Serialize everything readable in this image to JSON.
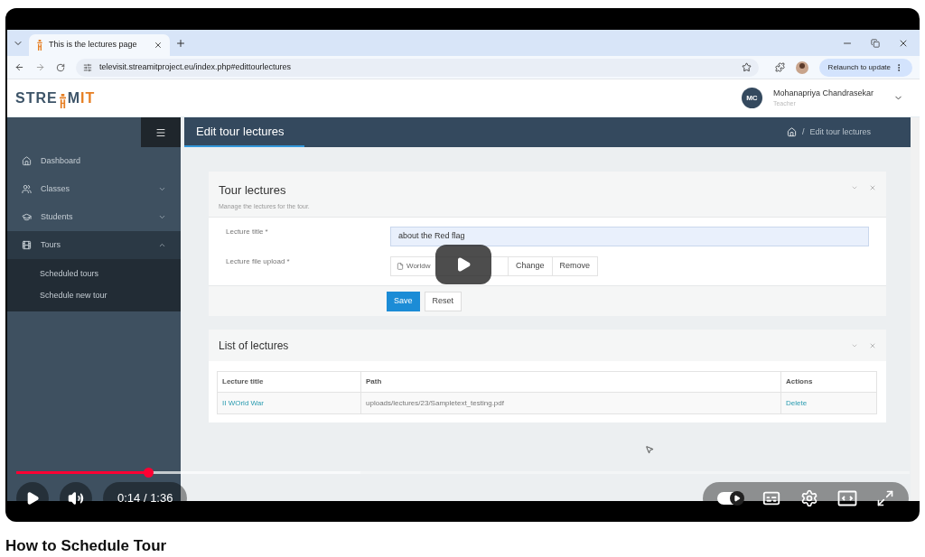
{
  "browser": {
    "tab": {
      "title": "This is the lectures page"
    },
    "url": "televisit.streamitproject.eu/index.php#edittourlectures",
    "relaunch_button": "Relaunch to update"
  },
  "site": {
    "logo": [
      "STRE",
      "M",
      "IT"
    ],
    "user": {
      "initials": "MC",
      "name": "Mohanapriya Chandrasekar",
      "role": "Teacher"
    }
  },
  "sidebar": {
    "items": [
      {
        "label": "Dashboard",
        "selected": false
      },
      {
        "label": "Classes",
        "selected": false,
        "expanded": false
      },
      {
        "label": "Students",
        "selected": false,
        "expanded": false
      },
      {
        "label": "Tours",
        "selected": true,
        "expanded": true,
        "children": [
          {
            "label": "Scheduled tours"
          },
          {
            "label": "Schedule new tour"
          }
        ]
      }
    ]
  },
  "header": {
    "title": "Edit tour lectures",
    "breadcrumb": [
      "/",
      "Edit tour lectures"
    ]
  },
  "form_panel": {
    "title": "Tour lectures",
    "subtitle": "Manage the lectures for the tour.",
    "title_field": {
      "label": "Lecture title *",
      "value": "about the Red flag"
    },
    "file_field": {
      "label": "Lecture file upload *",
      "file": "Worldw",
      "buttons": [
        "Change",
        "Remove"
      ]
    },
    "buttons": [
      "Save",
      "Reset"
    ]
  },
  "list_panel": {
    "title": "List of lectures",
    "table": {
      "columns": [
        "Lecture title",
        "Path",
        "Actions"
      ],
      "rows": [
        [
          "II WOrld War",
          "uploads/lectures/23/Sampletext_testing.pdf",
          "Delete"
        ]
      ]
    }
  },
  "player": {
    "progress": {
      "level": 0.148
    },
    "buffer": {
      "level": 0.385
    },
    "time": "0:14 / 1:36",
    "autoplay": {
      "on": true
    }
  },
  "video_title": "How to Schedule Tour"
}
